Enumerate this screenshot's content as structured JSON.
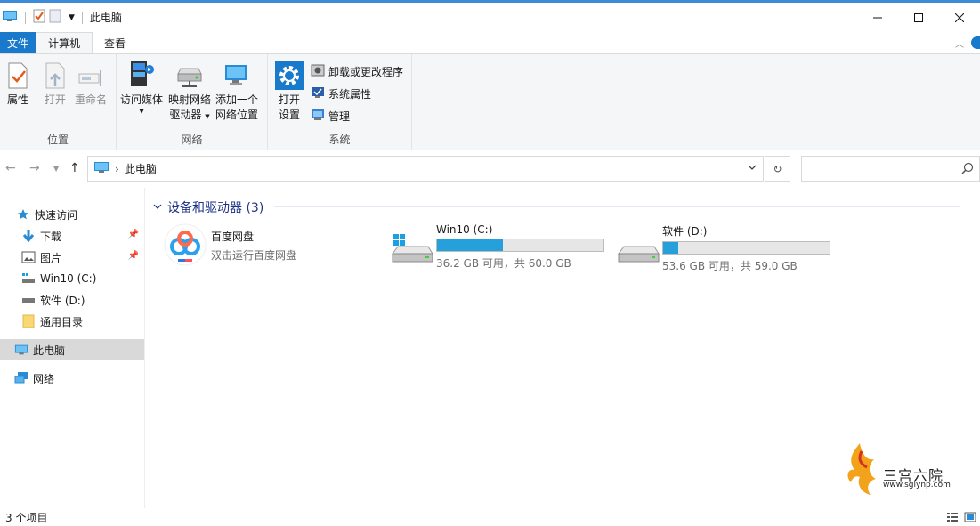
{
  "window": {
    "title": "此电脑"
  },
  "tabs": [
    {
      "label": "文件"
    },
    {
      "label": "计算机"
    },
    {
      "label": "查看"
    }
  ],
  "ribbon": {
    "groups": {
      "location": {
        "label": "位置",
        "buttons": [
          "属性",
          "打开",
          "重命名"
        ]
      },
      "network": {
        "label": "网络",
        "buttons": [
          {
            "line1": "访问媒体",
            "line2": ""
          },
          {
            "line1": "映射网络",
            "line2": "驱动器"
          },
          {
            "line1": "添加一个",
            "line2": "网络位置"
          }
        ]
      },
      "system": {
        "label": "系统",
        "open_settings": {
          "line1": "打开",
          "line2": "设置"
        },
        "small": [
          "卸载或更改程序",
          "系统属性",
          "管理"
        ]
      }
    }
  },
  "address": {
    "path": "此电脑",
    "search_placeholder": ""
  },
  "sidebar": {
    "items": [
      {
        "label": "快速访问"
      },
      {
        "label": "下载"
      },
      {
        "label": "图片"
      },
      {
        "label": "Win10 (C:)"
      },
      {
        "label": "软件 (D:)"
      },
      {
        "label": "通用目录"
      },
      {
        "label": "此电脑"
      },
      {
        "label": "网络"
      }
    ]
  },
  "content": {
    "section_title": "设备和驱动器 (3)",
    "items": [
      {
        "name": "百度网盘",
        "sub": "双击运行百度网盘"
      },
      {
        "name": "Win10 (C:)",
        "sub": "36.2 GB 可用，共 60.0 GB",
        "used_fraction": 0.397
      },
      {
        "name": "软件 (D:)",
        "sub": "53.6 GB 可用，共 59.0 GB",
        "used_fraction": 0.092
      }
    ]
  },
  "watermark": {
    "title": "三宫六院",
    "url": "www.sglynp.com"
  },
  "status": {
    "count": "3 个项目"
  },
  "colors": {
    "accent": "#1979ca",
    "bar_fill": "#26a0da",
    "section_title": "#1e3287"
  }
}
